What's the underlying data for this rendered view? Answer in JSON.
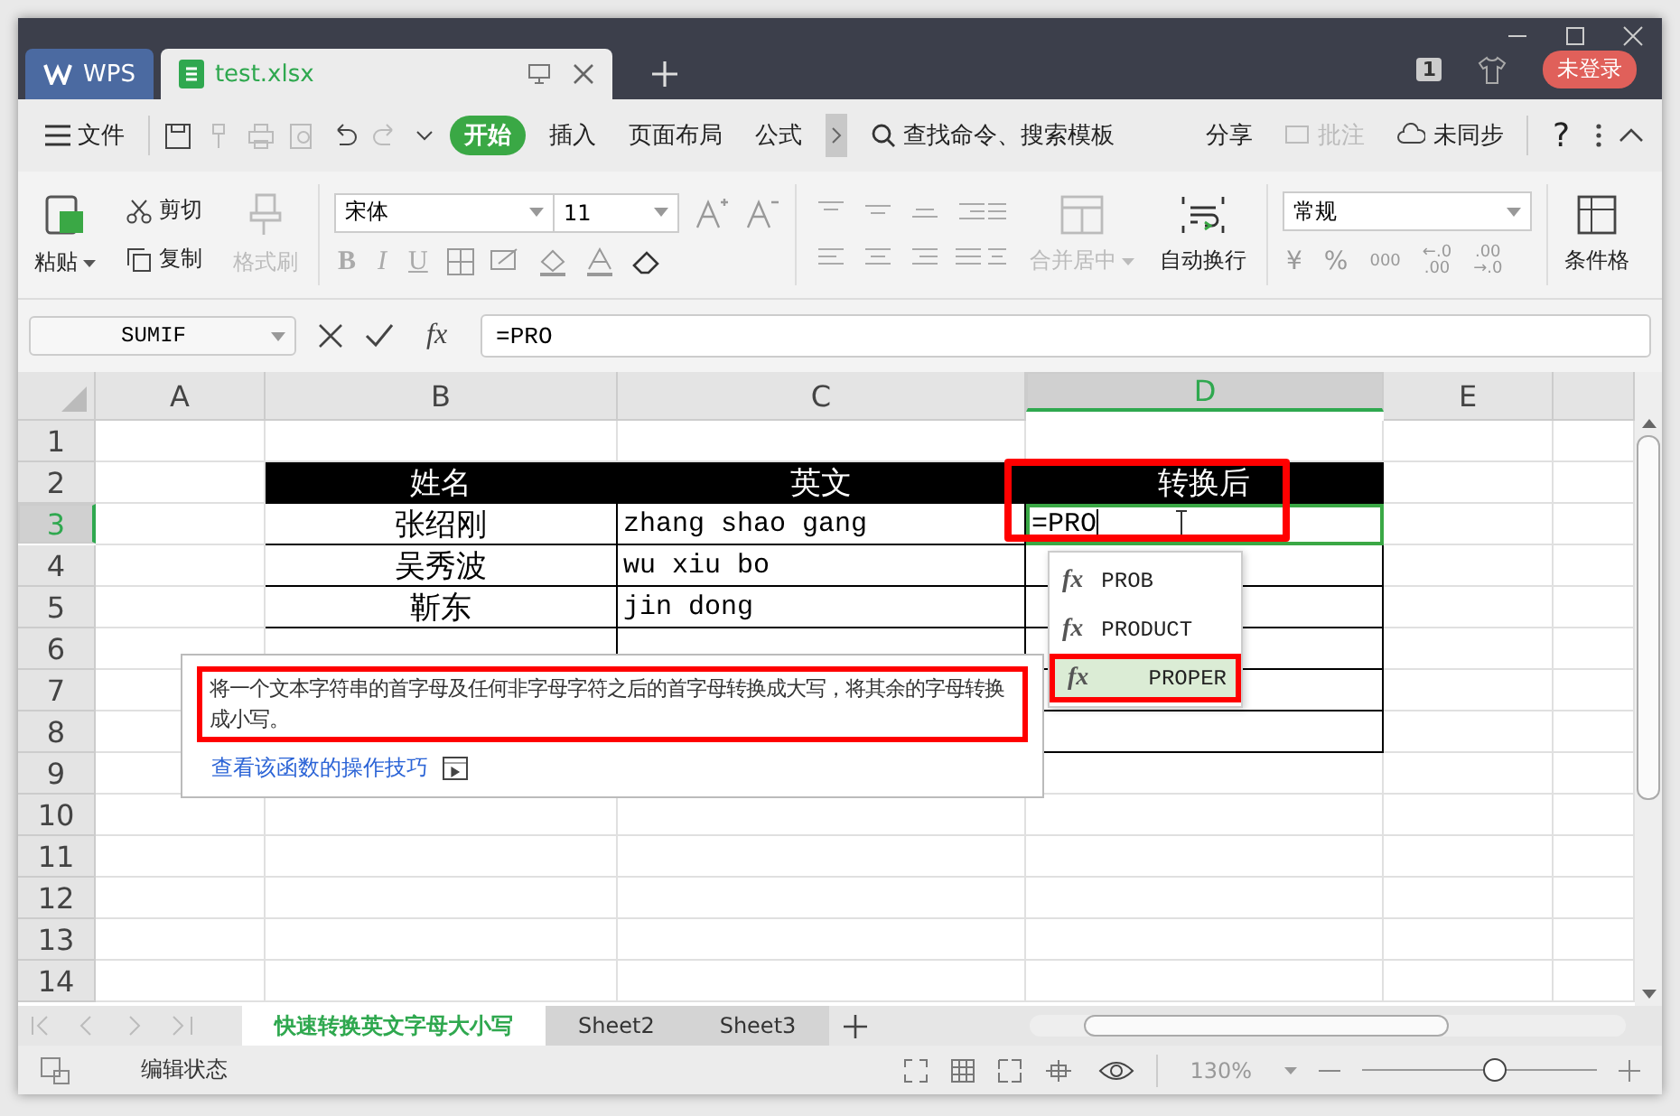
{
  "tabs": [
    {
      "label": "WPS",
      "kind": "home",
      "selected": false
    },
    {
      "label": "test.xlsx",
      "kind": "sheet",
      "selected": true
    }
  ],
  "title_bar": {
    "page_count": "1",
    "login": "未登录"
  },
  "menu": {
    "file": "文件",
    "tabs": [
      {
        "label": "开始",
        "selected": true
      },
      {
        "label": "插入",
        "selected": false
      },
      {
        "label": "页面布局",
        "selected": false
      },
      {
        "label": "公式",
        "selected": false
      }
    ],
    "search": "查找命令、搜索模板",
    "share": "分享",
    "comment": {
      "label": "批注",
      "disabled": true
    },
    "sync": "未同步",
    "help": "?"
  },
  "ribbon": {
    "paste": "粘贴",
    "cut": "剪切",
    "copy": "复制",
    "format_painter": {
      "label": "格式刷",
      "disabled": true
    },
    "font": "宋体",
    "size": "11",
    "font_styles": [
      "B",
      "I",
      "U"
    ],
    "merge": {
      "label": "合并居中",
      "disabled": true
    },
    "wrap": "自动换行",
    "number_format": "常规",
    "currency": "¥",
    "percent": "%",
    "thousands": "000",
    "decimal_increase": {
      "top": "←.0",
      "bottom": ".00"
    },
    "decimal_decrease": {
      "top": ".00",
      "bottom": "→.0"
    },
    "conditional": "条件格"
  },
  "formula_bar": {
    "name_box": "SUMIF",
    "fx": "fx",
    "formula": "=PRO"
  },
  "columns": [
    {
      "label": "A",
      "selected": false
    },
    {
      "label": "B",
      "selected": false
    },
    {
      "label": "C",
      "selected": false
    },
    {
      "label": "D",
      "selected": true
    },
    {
      "label": "E",
      "selected": false
    }
  ],
  "rows": [
    {
      "number": "1",
      "selected": false
    },
    {
      "number": "2",
      "selected": false
    },
    {
      "number": "3",
      "selected": true
    },
    {
      "number": "4",
      "selected": false
    },
    {
      "number": "5",
      "selected": false
    },
    {
      "number": "6",
      "selected": false
    },
    {
      "number": "7",
      "selected": false
    },
    {
      "number": "8",
      "selected": false
    },
    {
      "number": "9",
      "selected": false
    },
    {
      "number": "10",
      "selected": false
    },
    {
      "number": "11",
      "selected": false
    },
    {
      "number": "12",
      "selected": false
    },
    {
      "number": "13",
      "selected": false
    },
    {
      "number": "14",
      "selected": false
    }
  ],
  "table": {
    "header": [
      "姓名",
      "英文",
      "转换后"
    ],
    "rows": [
      [
        "张绍刚",
        "zhang shao gang"
      ],
      [
        "吴秀波",
        "wu xiu bo"
      ],
      [
        "靳东",
        "jin dong"
      ]
    ],
    "editing": {
      "value": "=PRO",
      "highlighted": true
    }
  },
  "autocomplete": [
    {
      "icon": "fx",
      "name": "PROB",
      "selected": false,
      "highlighted": false
    },
    {
      "icon": "fx",
      "name": "PRODUCT",
      "selected": false,
      "highlighted": false
    },
    {
      "icon": "fx",
      "name": "PROPER",
      "selected": true,
      "highlighted": true
    }
  ],
  "tooltip": {
    "description": "将一个文本字符串的首字母及任何非字母字符之后的首字母转换成大写，将其余的字母转换成小写。",
    "highlighted": true,
    "link": "查看该函数的操作技巧"
  },
  "sheets": [
    {
      "label": "快速转换英文字母大小写",
      "selected": true
    },
    {
      "label": "Sheet2",
      "selected": false
    },
    {
      "label": "Sheet3",
      "selected": false
    }
  ],
  "status_bar": {
    "mode": "编辑状态",
    "zoom": "130%",
    "zoom_slider": {
      "level": 0.56
    }
  }
}
